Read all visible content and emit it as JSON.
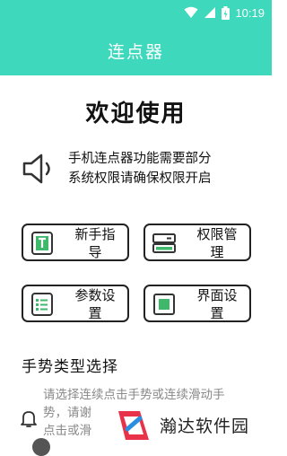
{
  "status_bar": {
    "time": "10:19",
    "icons": [
      "wifi-icon",
      "signal-icon",
      "battery-icon"
    ]
  },
  "app_bar": {
    "title": "连点器"
  },
  "welcome": "欢迎使用",
  "notice": {
    "line1": "手机连点器功能需要部分",
    "line2": "系统权限请确保权限开启",
    "icon": "speaker-icon"
  },
  "cards": [
    {
      "line1": "新手指",
      "line2": "导",
      "icon": "guide-icon"
    },
    {
      "line1": "权限管",
      "line2": "理",
      "icon": "permission-icon"
    },
    {
      "line1": "参数设",
      "line2": "置",
      "icon": "list-icon"
    },
    {
      "line1": "界面设",
      "line2": "置",
      "icon": "interface-icon"
    }
  ],
  "section": {
    "title": "手势类型选择",
    "desc_line1": "请选择连续点击手势或连续滑动手",
    "desc_line2": "势，请谢",
    "desc_line3": "点击或滑"
  },
  "watermark": {
    "text": "瀚达软件园"
  },
  "colors": {
    "accent": "#3ed9bd",
    "icon_green": "#3fb86b"
  }
}
